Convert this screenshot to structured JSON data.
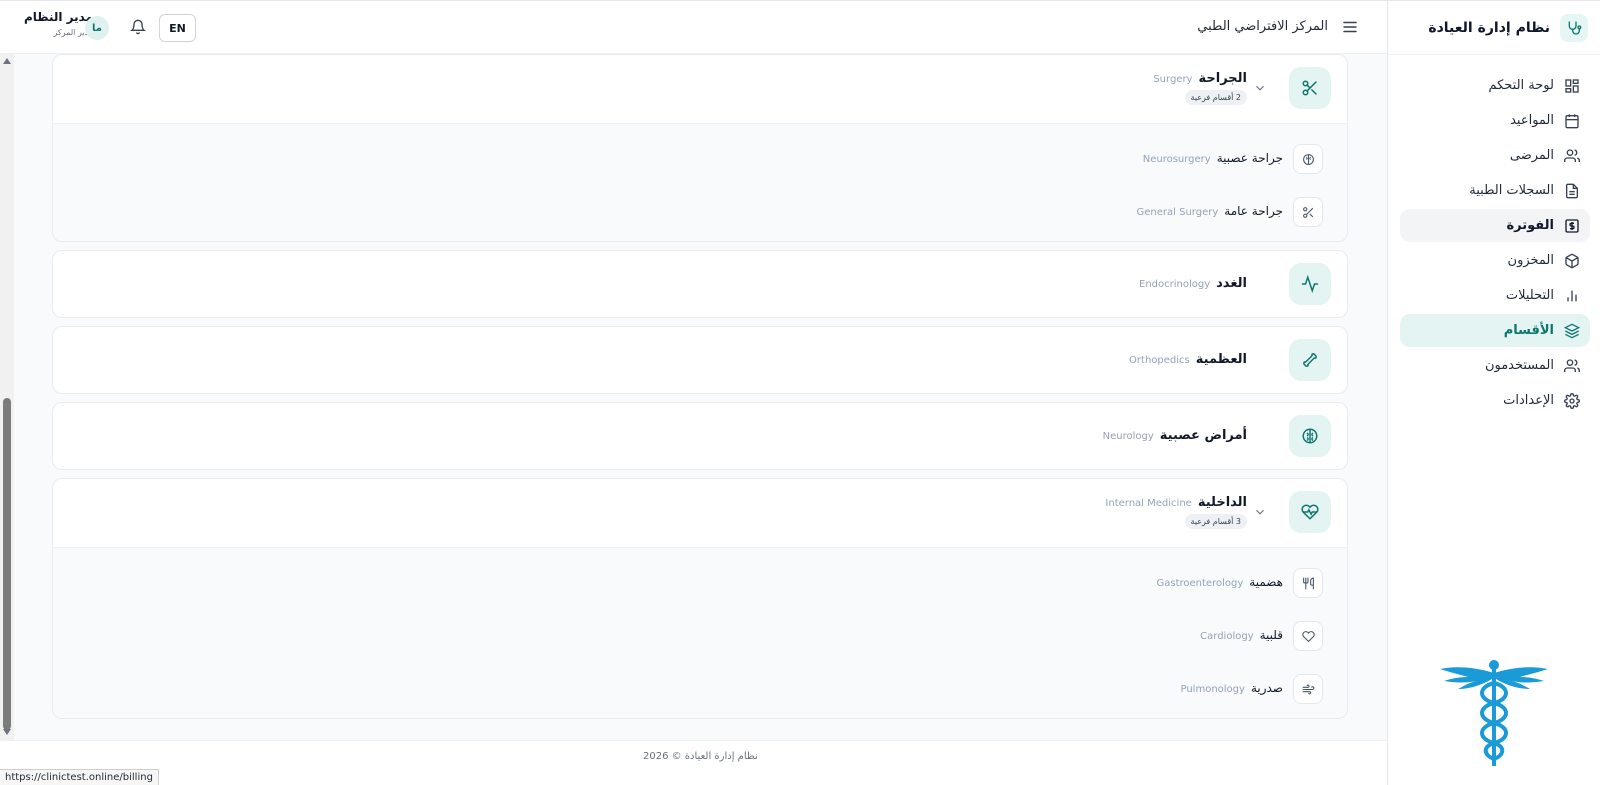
{
  "app": {
    "title": "نظام إدارة العيادة",
    "center_name": "المركز الافتراضي الطبي",
    "language_button": "EN",
    "user_name": "مدير النظام",
    "user_role": "مدير المركز",
    "avatar_initials": "ما"
  },
  "sidebar": {
    "items": [
      {
        "label": "لوحة التحكم",
        "icon": "dashboard-icon"
      },
      {
        "label": "المواعيد",
        "icon": "calendar-icon"
      },
      {
        "label": "المرضى",
        "icon": "users-icon"
      },
      {
        "label": "السجلات الطبية",
        "icon": "file-text-icon"
      },
      {
        "label": "الفوترة",
        "icon": "billing-icon"
      },
      {
        "label": "المخزون",
        "icon": "box-icon"
      },
      {
        "label": "التحليلات",
        "icon": "bar-chart-icon"
      },
      {
        "label": "الأقسام",
        "icon": "layers-icon"
      },
      {
        "label": "المستخدمون",
        "icon": "users-icon"
      },
      {
        "label": "الإعدادات",
        "icon": "settings-icon"
      }
    ],
    "hovered_index": 4,
    "active_index": 7
  },
  "departments": [
    {
      "name_ar": "الجراحة",
      "name_en": "Surgery",
      "badge": "2 أقسام فرعية",
      "icon": "scissors-icon",
      "expanded": true,
      "subs": [
        {
          "name_ar": "جراحة عصبية",
          "name_en": "Neurosurgery",
          "icon": "brain-icon"
        },
        {
          "name_ar": "جراحة عامة",
          "name_en": "General Surgery",
          "icon": "scissors-icon"
        }
      ]
    },
    {
      "name_ar": "الغدد",
      "name_en": "Endocrinology",
      "icon": "activity-icon"
    },
    {
      "name_ar": "العظمية",
      "name_en": "Orthopedics",
      "icon": "bone-icon"
    },
    {
      "name_ar": "أمراض عصبية",
      "name_en": "Neurology",
      "icon": "brain-icon"
    },
    {
      "name_ar": "الداخلية",
      "name_en": "Internal Medicine",
      "badge": "3 أقسام فرعية",
      "icon": "heart-pulse-icon",
      "expanded": true,
      "subs": [
        {
          "name_ar": "هضمية",
          "name_en": "Gastroenterology",
          "icon": "utensils-icon"
        },
        {
          "name_ar": "قلبية",
          "name_en": "Cardiology",
          "icon": "heart-icon"
        },
        {
          "name_ar": "صدرية",
          "name_en": "Pulmonology",
          "icon": "wind-icon"
        }
      ]
    }
  ],
  "footer": {
    "text": "نظام إدارة العيادة © 2026"
  },
  "status_bar": {
    "url": "https://clinictest.online/billing"
  },
  "colors": {
    "accent": "#0f766e",
    "accent_bg": "#e3f4f2",
    "muted": "#94a3b8"
  }
}
